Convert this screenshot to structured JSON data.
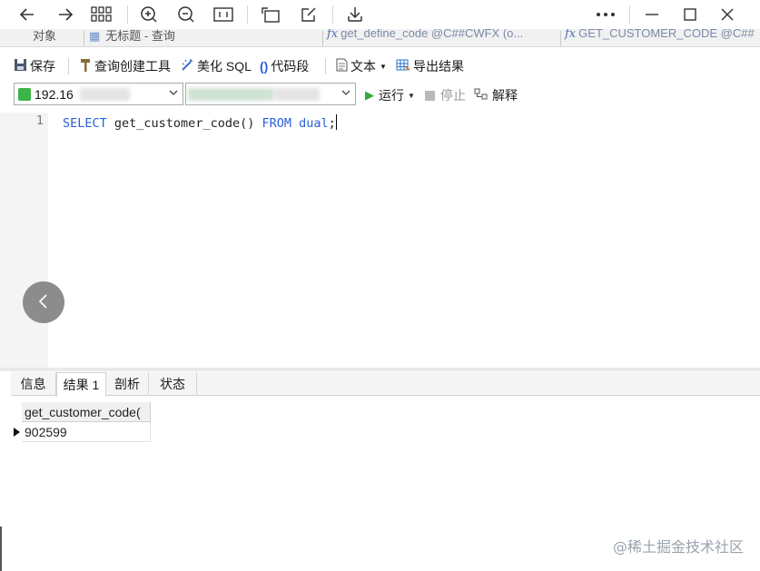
{
  "viewer": {
    "icons": [
      "back-arrow-icon",
      "forward-arrow-icon",
      "grid-view-icon",
      "zoom-in-icon",
      "zoom-out-icon",
      "actual-size-icon",
      "rotate-icon",
      "edit-icon",
      "download-icon",
      "more-icon",
      "minimize-icon",
      "maximize-icon",
      "close-icon"
    ]
  },
  "tabs": {
    "fragments": [
      "对象",
      "无标题 - 查询",
      "get_define_code @C##CWFX (o...",
      "GET_CUSTOMER_CODE @C##"
    ]
  },
  "toolbar": {
    "save": "保存",
    "query_builder": "查询创建工具",
    "beautify": "美化 SQL",
    "snippet": "代码段",
    "text": "文本",
    "export": "导出结果"
  },
  "connection": {
    "host": "192.16",
    "run": "运行",
    "stop": "停止",
    "explain": "解释"
  },
  "editor": {
    "line_number": "1",
    "code_keyword1": "SELECT",
    "code_middle": " get_customer_code() ",
    "code_keyword2": "FROM",
    "code_space": " ",
    "code_keyword3": "dual",
    "code_end": ";"
  },
  "result_tabs": [
    "信息",
    "结果 1",
    "剖析",
    "状态"
  ],
  "grid": {
    "columns": [
      "get_customer_code("
    ],
    "rows": [
      [
        "902599"
      ]
    ]
  },
  "watermark": "@稀土掘金技术社区",
  "colors": {
    "keyword": "#2b5fd9",
    "run_green": "#2faa3c",
    "conn_green": "#3cb44a"
  }
}
